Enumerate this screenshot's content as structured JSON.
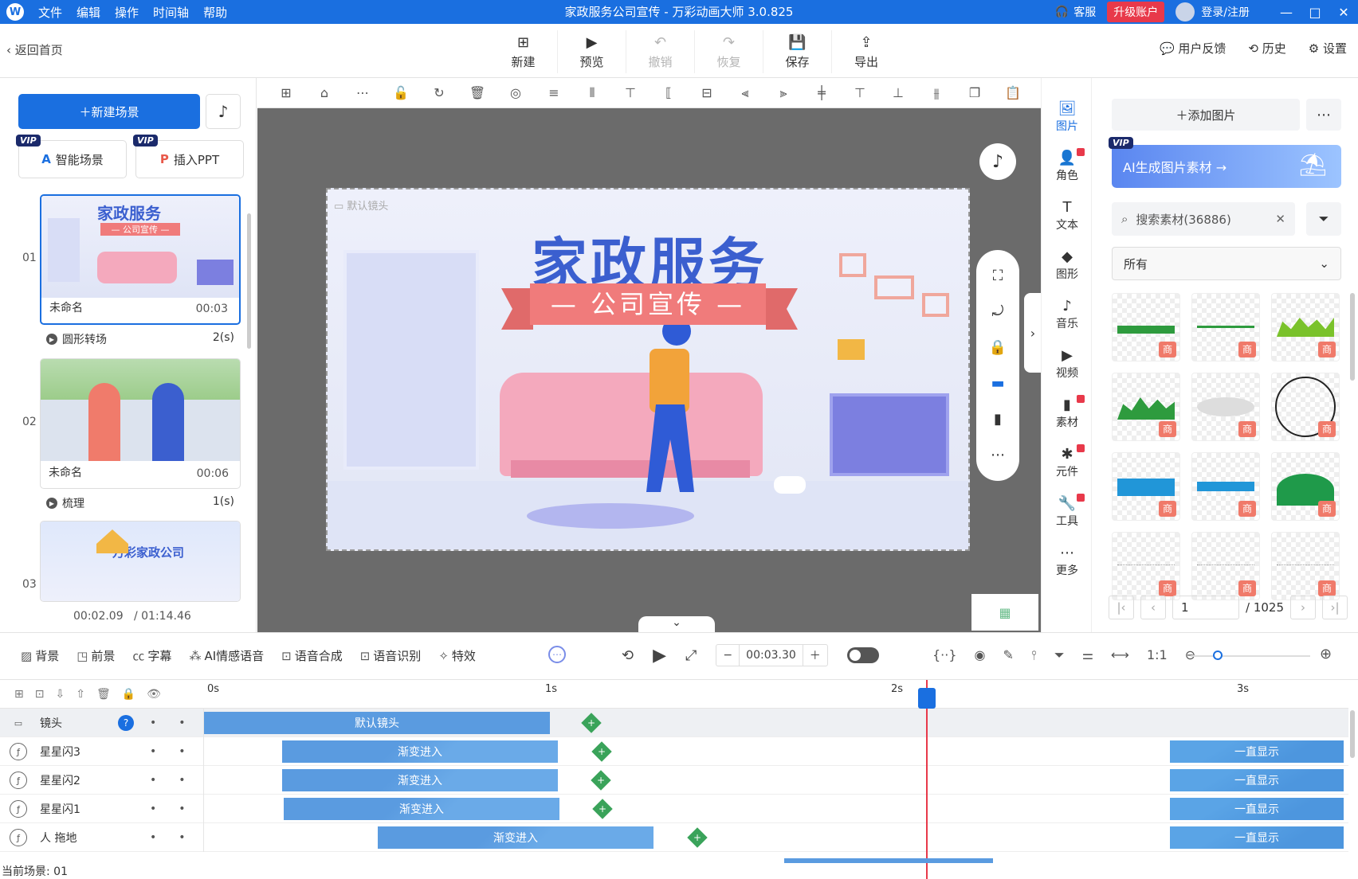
{
  "app": {
    "title": "家政服务公司宣传 - 万彩动画大师 3.0.825",
    "logo_letter": "W",
    "menu": [
      "文件",
      "编辑",
      "操作",
      "时间轴",
      "帮助"
    ],
    "service_label": "客服",
    "upgrade_label": "升级账户",
    "login_label": "登录/注册",
    "win_controls": [
      "—",
      "□",
      "✕"
    ],
    "accent_color": "#1a6fe0"
  },
  "toolbar": {
    "back_label": "返回首页",
    "buttons": [
      {
        "label": "新建",
        "icon": "new-icon",
        "glyph": "⊞",
        "enabled": true
      },
      {
        "label": "预览",
        "icon": "play-icon",
        "glyph": "▶",
        "enabled": true
      },
      {
        "label": "撤销",
        "icon": "undo-icon",
        "glyph": "↶",
        "enabled": false
      },
      {
        "label": "恢复",
        "icon": "redo-icon",
        "glyph": "↷",
        "enabled": false
      },
      {
        "label": "保存",
        "icon": "save-icon",
        "glyph": "💾",
        "enabled": true
      },
      {
        "label": "导出",
        "icon": "export-icon",
        "glyph": "⇪",
        "enabled": true
      }
    ],
    "feedback_label": "用户反馈",
    "history_label": "历史",
    "settings_label": "设置"
  },
  "scenes": {
    "new_scene_label": "新建场景",
    "smart_scene_label": "智能场景",
    "insert_ppt_label": "插入PPT",
    "vip_badge": "VIP",
    "items": [
      {
        "num": "01",
        "name": "未命名",
        "duration": "00:03",
        "transition": "圆形转场",
        "transition_time": "2(s)",
        "thumb_text": "家政服务",
        "thumb_sub": "— 公司宣传 —"
      },
      {
        "num": "02",
        "name": "未命名",
        "duration": "00:06",
        "transition": "梳理",
        "transition_time": "1(s)"
      },
      {
        "num": "03",
        "thumb_text": "万彩家政公司"
      }
    ],
    "current_time": "00:02.09",
    "total_time": "/ 01:14.46"
  },
  "canvas": {
    "camera_label": "默认镜头",
    "headline": "家政服务",
    "ribbon_text": "— 公司宣传 —",
    "stage_colors": {
      "headline": "#3b5fcf",
      "ribbon": "#f07b7b",
      "sofa": "#f4a9bd"
    }
  },
  "sidenav": {
    "items": [
      {
        "label": "图片",
        "icon": "image-icon",
        "glyph": "🖼",
        "active": true,
        "dot": false
      },
      {
        "label": "角色",
        "icon": "character-icon",
        "glyph": "👤",
        "active": false,
        "dot": true
      },
      {
        "label": "文本",
        "icon": "text-icon",
        "glyph": "T",
        "active": false,
        "dot": false
      },
      {
        "label": "图形",
        "icon": "shape-icon",
        "glyph": "◆",
        "active": false,
        "dot": false
      },
      {
        "label": "音乐",
        "icon": "music-icon",
        "glyph": "♪",
        "active": false,
        "dot": false
      },
      {
        "label": "视频",
        "icon": "video-icon",
        "glyph": "▶",
        "active": false,
        "dot": false
      },
      {
        "label": "素材",
        "icon": "material-icon",
        "glyph": "▮",
        "active": false,
        "dot": true
      },
      {
        "label": "元件",
        "icon": "component-icon",
        "glyph": "✱",
        "active": false,
        "dot": true
      },
      {
        "label": "工具",
        "icon": "tool-icon",
        "glyph": "🔧",
        "active": false,
        "dot": true
      },
      {
        "label": "更多",
        "icon": "more-icon",
        "glyph": "⋯",
        "active": false,
        "dot": false
      }
    ]
  },
  "assets": {
    "add_image_label": "添加图片",
    "ai_banner_label": "AI生成图片素材 →",
    "search_placeholder": "搜索素材(36886)",
    "filter_select": "所有",
    "shang_badge": "商",
    "page_current": "1",
    "page_total": "/ 1025"
  },
  "timeline_toolbar": {
    "left": [
      {
        "label": "背景",
        "icon": "background-icon",
        "glyph": "▨"
      },
      {
        "label": "前景",
        "icon": "foreground-icon",
        "glyph": "◳"
      },
      {
        "label": "字幕",
        "icon": "subtitle-icon",
        "glyph": "㏄"
      },
      {
        "label": "AI情感语音",
        "icon": "ai-voice-icon",
        "glyph": "⁂"
      },
      {
        "label": "语音合成",
        "icon": "tts-icon",
        "glyph": "⊡"
      },
      {
        "label": "语音识别",
        "icon": "asr-icon",
        "glyph": "⊡"
      },
      {
        "label": "特效",
        "icon": "effect-icon",
        "glyph": "✧"
      }
    ],
    "time_value": "00:03.30"
  },
  "timeline": {
    "ruler": [
      "0s",
      "1s",
      "2s",
      "3s"
    ],
    "tracks": [
      {
        "name": "镜头",
        "icon": "camera-icon",
        "bars": [
          {
            "label": "默认镜头",
            "kind": "solid"
          }
        ],
        "selected": true
      },
      {
        "name": "星星闪3",
        "icon": "effect-icon",
        "bars": [
          {
            "label": "渐变进入",
            "kind": "grad"
          },
          {
            "label": "一直显示",
            "kind": "show"
          }
        ]
      },
      {
        "name": "星星闪2",
        "icon": "effect-icon",
        "bars": [
          {
            "label": "渐变进入",
            "kind": "grad"
          },
          {
            "label": "一直显示",
            "kind": "show"
          }
        ]
      },
      {
        "name": "星星闪1",
        "icon": "effect-icon",
        "bars": [
          {
            "label": "渐变进入",
            "kind": "grad"
          },
          {
            "label": "一直显示",
            "kind": "show"
          }
        ]
      },
      {
        "name": "人 拖地",
        "icon": "effect-icon",
        "bars": [
          {
            "label": "渐变进入",
            "kind": "grad"
          },
          {
            "label": "一直显示",
            "kind": "show"
          }
        ]
      }
    ],
    "status_label": "当前场景: 01"
  }
}
